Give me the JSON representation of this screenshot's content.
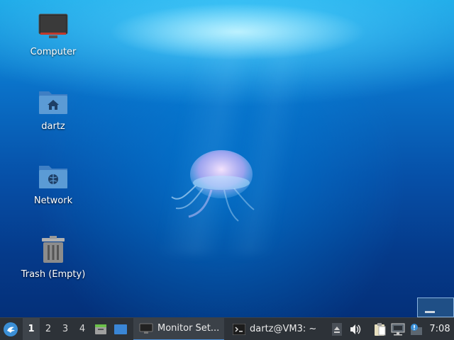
{
  "desktop": {
    "icons": [
      {
        "label": "Computer",
        "icon": "computer-icon"
      },
      {
        "label": "dartz",
        "icon": "home-folder-icon"
      },
      {
        "label": "Network",
        "icon": "network-folder-icon"
      },
      {
        "label": "Trash (Empty)",
        "icon": "trash-icon"
      }
    ]
  },
  "taskbar": {
    "workspaces": [
      "1",
      "2",
      "3",
      "4"
    ],
    "active_workspace": "1",
    "tasks": [
      {
        "label": "Monitor Set...",
        "icon": "monitor-icon",
        "active": true
      },
      {
        "label": "dartz@VM3: ~",
        "icon": "terminal-icon",
        "active": false
      }
    ],
    "clock": "7:08"
  },
  "colors": {
    "accent": "#4a90d9",
    "folder": "#5b9bd5",
    "taskbar": "#2d3238"
  }
}
